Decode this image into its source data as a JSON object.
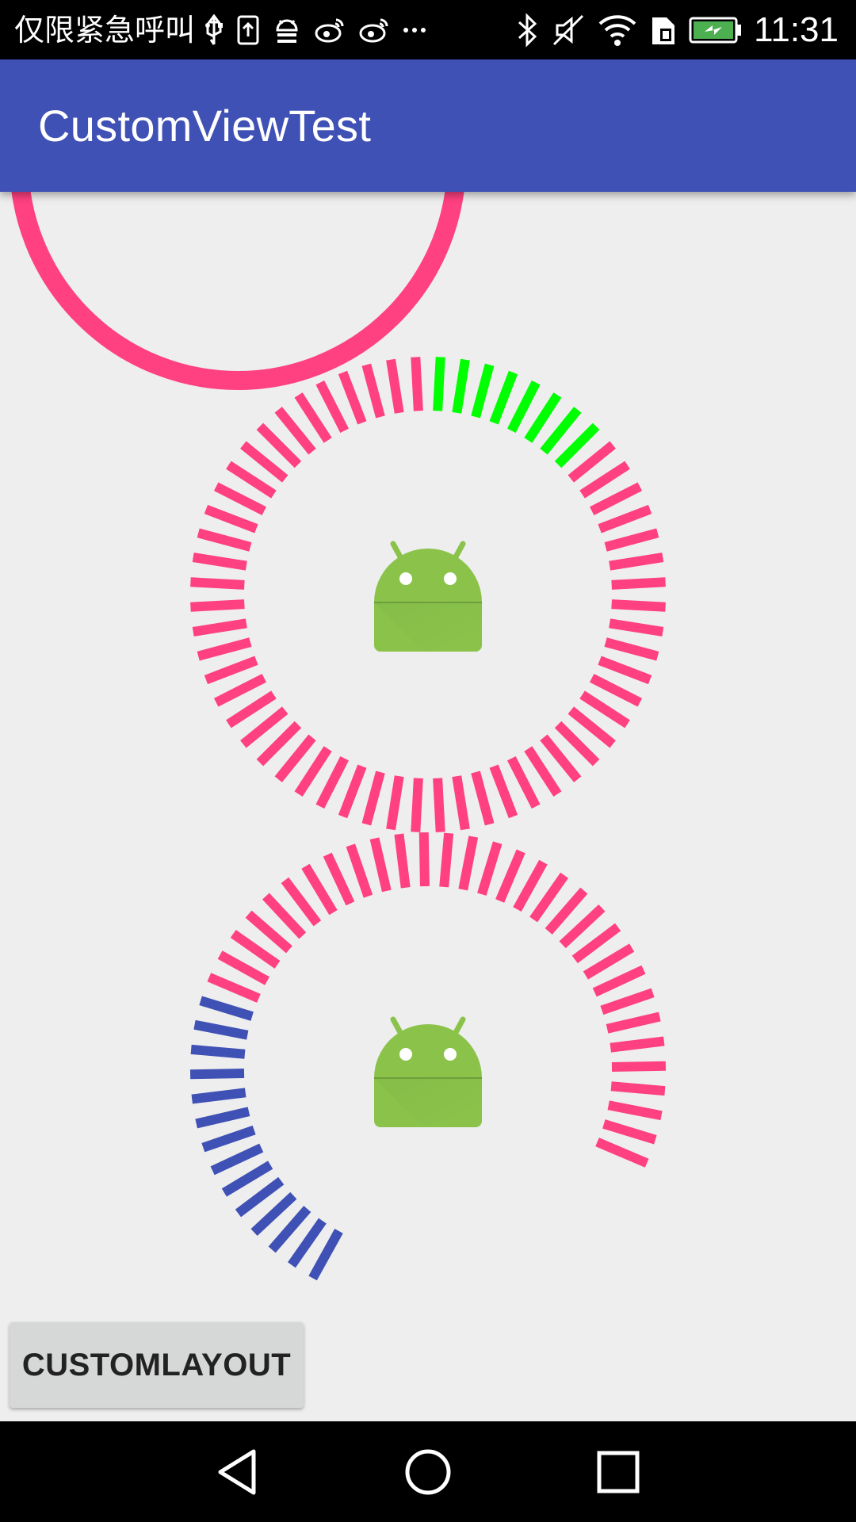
{
  "status_bar": {
    "carrier_text": "仅限紧急呼叫",
    "time": "11:31",
    "left_icons": [
      "usb-icon",
      "upload-icon",
      "android-debug-icon",
      "weibo-icon",
      "weibo-icon",
      "more-icon"
    ],
    "right_icons": [
      "bluetooth-icon",
      "mute-icon",
      "wifi-icon",
      "sim-icon",
      "battery-charging-icon"
    ],
    "battery_color": "#4caf50"
  },
  "app_bar": {
    "title": "CustomViewTest",
    "color": "#3f51b5"
  },
  "views": {
    "top_ring": {
      "color": "#ff4081"
    },
    "dial_one": {
      "tick_count": 60,
      "highlighted_ticks": 8,
      "highlight_color": "#00ff00",
      "base_color": "#ff4081",
      "icon": "android-robot-icon"
    },
    "dial_two": {
      "tick_count": 60,
      "visible_ticks": 45,
      "highlighted_ticks": 14,
      "highlight_color": "#3f51b5",
      "base_color": "#ff4081",
      "icon": "android-robot-icon"
    }
  },
  "button": {
    "label": "CUSTOMLAYOUT"
  },
  "nav_bar": {
    "buttons": [
      "back-icon",
      "home-icon",
      "recents-icon"
    ]
  }
}
